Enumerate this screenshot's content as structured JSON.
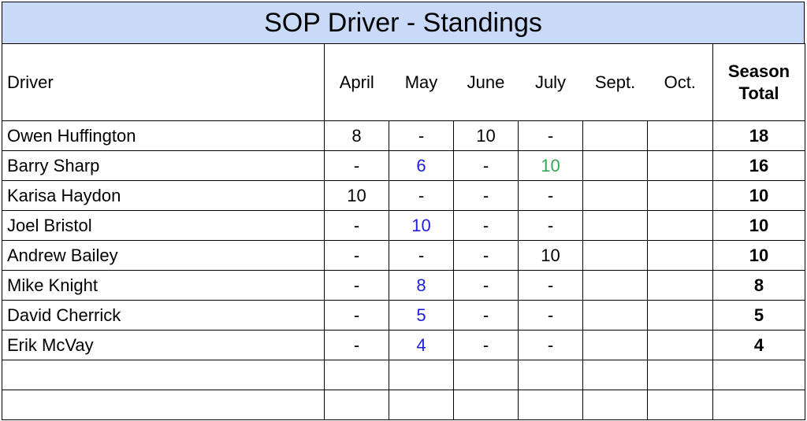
{
  "title": "SOP Driver - Standings",
  "columns": {
    "driver": "Driver",
    "months": [
      "April",
      "May",
      "June",
      "July",
      "Sept.",
      "Oct."
    ],
    "total_line1": "Season",
    "total_line2": "Total"
  },
  "colors": {
    "title_bg": "#c9daf8",
    "blue_value": "#1f1fd8",
    "green_value": "#34a853"
  },
  "rows": [
    {
      "name": "Owen Huffington",
      "cells": [
        {
          "v": "8",
          "c": "black"
        },
        {
          "v": "-",
          "c": "black"
        },
        {
          "v": "10",
          "c": "black"
        },
        {
          "v": "-",
          "c": "black"
        },
        {
          "v": "",
          "c": "black"
        },
        {
          "v": "",
          "c": "black"
        }
      ],
      "total": "18"
    },
    {
      "name": "Barry Sharp",
      "cells": [
        {
          "v": "-",
          "c": "black"
        },
        {
          "v": "6",
          "c": "blue"
        },
        {
          "v": "-",
          "c": "black"
        },
        {
          "v": "10",
          "c": "green"
        },
        {
          "v": "",
          "c": "black"
        },
        {
          "v": "",
          "c": "black"
        }
      ],
      "total": "16"
    },
    {
      "name": "Karisa Haydon",
      "cells": [
        {
          "v": "10",
          "c": "black"
        },
        {
          "v": "-",
          "c": "black"
        },
        {
          "v": "-",
          "c": "black"
        },
        {
          "v": "-",
          "c": "black"
        },
        {
          "v": "",
          "c": "black"
        },
        {
          "v": "",
          "c": "black"
        }
      ],
      "total": "10"
    },
    {
      "name": "Joel Bristol",
      "cells": [
        {
          "v": "-",
          "c": "black"
        },
        {
          "v": "10",
          "c": "blue"
        },
        {
          "v": "-",
          "c": "black"
        },
        {
          "v": "-",
          "c": "black"
        },
        {
          "v": "",
          "c": "black"
        },
        {
          "v": "",
          "c": "black"
        }
      ],
      "total": "10"
    },
    {
      "name": "Andrew Bailey",
      "cells": [
        {
          "v": "-",
          "c": "black"
        },
        {
          "v": "-",
          "c": "black"
        },
        {
          "v": "-",
          "c": "black"
        },
        {
          "v": "10",
          "c": "black"
        },
        {
          "v": "",
          "c": "black"
        },
        {
          "v": "",
          "c": "black"
        }
      ],
      "total": "10"
    },
    {
      "name": "Mike Knight",
      "cells": [
        {
          "v": "-",
          "c": "black"
        },
        {
          "v": "8",
          "c": "blue"
        },
        {
          "v": "-",
          "c": "black"
        },
        {
          "v": "-",
          "c": "black"
        },
        {
          "v": "",
          "c": "black"
        },
        {
          "v": "",
          "c": "black"
        }
      ],
      "total": "8"
    },
    {
      "name": "David Cherrick",
      "cells": [
        {
          "v": "-",
          "c": "black"
        },
        {
          "v": "5",
          "c": "blue"
        },
        {
          "v": "-",
          "c": "black"
        },
        {
          "v": "-",
          "c": "black"
        },
        {
          "v": "",
          "c": "black"
        },
        {
          "v": "",
          "c": "black"
        }
      ],
      "total": "5"
    },
    {
      "name": "Erik McVay",
      "cells": [
        {
          "v": "-",
          "c": "black"
        },
        {
          "v": "4",
          "c": "blue"
        },
        {
          "v": "-",
          "c": "black"
        },
        {
          "v": "-",
          "c": "black"
        },
        {
          "v": "",
          "c": "black"
        },
        {
          "v": "",
          "c": "black"
        }
      ],
      "total": "4"
    },
    {
      "name": "",
      "cells": [
        {
          "v": "",
          "c": "black"
        },
        {
          "v": "",
          "c": "black"
        },
        {
          "v": "",
          "c": "black"
        },
        {
          "v": "",
          "c": "black"
        },
        {
          "v": "",
          "c": "black"
        },
        {
          "v": "",
          "c": "black"
        }
      ],
      "total": ""
    },
    {
      "name": "",
      "cells": [
        {
          "v": "",
          "c": "black"
        },
        {
          "v": "",
          "c": "black"
        },
        {
          "v": "",
          "c": "black"
        },
        {
          "v": "",
          "c": "black"
        },
        {
          "v": "",
          "c": "black"
        },
        {
          "v": "",
          "c": "black"
        }
      ],
      "total": ""
    }
  ]
}
